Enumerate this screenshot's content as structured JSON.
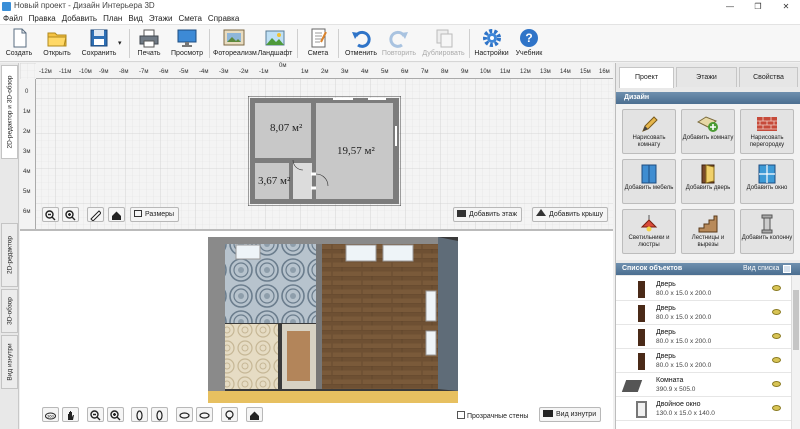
{
  "window": {
    "title": "Новый проект - Дизайн Интерьера 3D"
  },
  "menu": [
    "Файл",
    "Правка",
    "Добавить",
    "План",
    "Вид",
    "Этажи",
    "Смета",
    "Справка"
  ],
  "toolbar": {
    "create": "Создать",
    "open": "Открыть",
    "save": "Сохранить",
    "print": "Печать",
    "preview": "Просмотр",
    "photo": "Фотореализм",
    "landscape": "Ландшафт",
    "estimate": "Смета",
    "undo": "Отменить",
    "redo": "Повторить",
    "duplicate": "Дублировать",
    "settings": "Настройки",
    "tutorial": "Учебник"
  },
  "left_tabs": {
    "tab1": "2D-редактор и 3D-обзор",
    "tab2": "2D-редактор",
    "tab3": "3D-обзор",
    "tab4": "Вид изнутри"
  },
  "ruler": {
    "top": [
      "-12м",
      "-11м",
      "-10м",
      "-9м",
      "-8м",
      "-7м",
      "-6м",
      "-5м",
      "-4м",
      "-3м",
      "-2м",
      "-1м",
      "0м",
      "1м",
      "2м",
      "3м",
      "4м",
      "5м",
      "6м",
      "7м",
      "8м",
      "9м",
      "10м",
      "11м",
      "12м",
      "13м",
      "14м",
      "15м",
      "16м"
    ],
    "left": [
      "0",
      "1м",
      "2м",
      "3м",
      "4м",
      "5м",
      "6м"
    ]
  },
  "plan": {
    "room1_area": "8,07 м²",
    "room2_area": "19,57 м²",
    "room3_area": "3,67 м²"
  },
  "view2d": {
    "sizes_label": "Размеры",
    "add_floor": "Добавить этаж",
    "add_roof": "Добавить крышу"
  },
  "view3d": {
    "transparent_walls": "Прозрачные стены",
    "inside_view": "Вид изнутри"
  },
  "right": {
    "tabs": [
      "Проект",
      "Этажи",
      "Свойства"
    ],
    "design_header": "Дизайн",
    "tiles": [
      "Нарисовать комнату",
      "Добавить комнату",
      "Нарисовать перегородку",
      "Добавить мебель",
      "Добавить дверь",
      "Добавить окно",
      "Светильники и люстры",
      "Лестницы и вырезы",
      "Добавить колонну"
    ],
    "objects_header": "Список объектов",
    "view_list": "Вид списка",
    "objects": [
      {
        "name": "Дверь",
        "dims": "80.0 x 15.0 x 200.0"
      },
      {
        "name": "Дверь",
        "dims": "80.0 x 15.0 x 200.0"
      },
      {
        "name": "Дверь",
        "dims": "80.0 x 15.0 x 200.0"
      },
      {
        "name": "Дверь",
        "dims": "80.0 x 15.0 x 200.0"
      },
      {
        "name": "Комната",
        "dims": "390.9 x 505.0"
      },
      {
        "name": "Двойное окно",
        "dims": "130.0 x 15.0 x 140.0"
      }
    ]
  }
}
